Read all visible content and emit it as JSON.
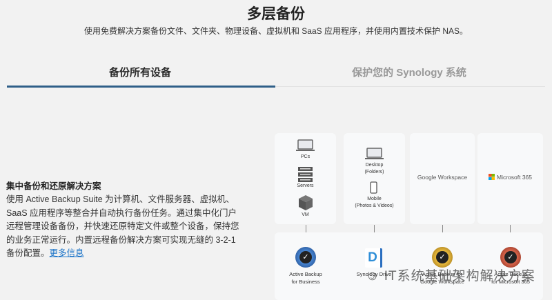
{
  "header": {
    "title": "多层备份",
    "subtitle": "使用免费解决方案备份文件、文件夹、物理设备、虚拟机和 SaaS 应用程序，并使用内置技术保护 NAS。"
  },
  "tabs": [
    {
      "label": "备份所有设备",
      "active": true
    },
    {
      "label": "保护您的 Synology 系统",
      "active": false
    }
  ],
  "section": {
    "heading": "集中备份和还原解决方案",
    "body": "使用 Active Backup Suite 为计算机、文件服务器、虚拟机、SaaS 应用程序等整合并自动执行备份任务。通过集中化门户远程管理设备备份，并快速还原特定文件或整个设备，保持您的业务正常运行。内置远程备份解决方案可实现无缝的 3-2-1 备份配置。",
    "link": "更多信息"
  },
  "diagram": {
    "sources": {
      "pcs": "PCs",
      "servers": "Servers",
      "vm": "VM",
      "desktop": "Desktop",
      "desktop_sub": "(Folders)",
      "mobile": "Mobile",
      "mobile_sub": "(Photos & Videos)",
      "google": "Google Workspace",
      "microsoft": "Microsoft 365"
    },
    "apps": [
      {
        "line1": "Active Backup",
        "line2": "for Business",
        "color": "#2a5fa8"
      },
      {
        "line1": "Synology Drive",
        "line2": "",
        "color": "#2f8fd8"
      },
      {
        "line1": "Active Backup for",
        "line2": "Google Workspace",
        "color": "#d4a21c"
      },
      {
        "line1": "Active Backup",
        "line2": "for Microsoft 365",
        "color": "#b8432c"
      }
    ]
  },
  "watermark": "IT系统基础架构解决方案"
}
